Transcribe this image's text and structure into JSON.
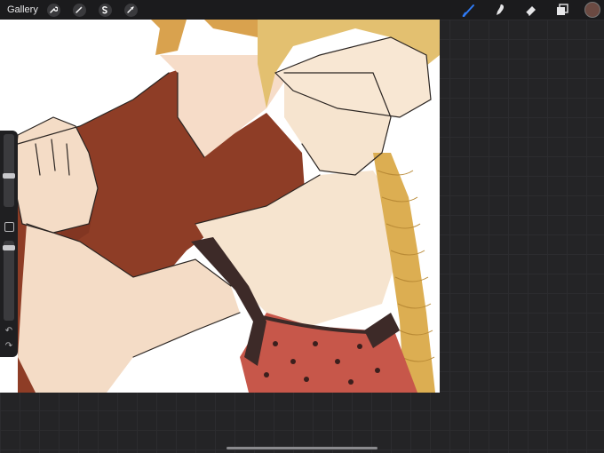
{
  "toolbar": {
    "gallery_label": "Gallery",
    "left_tools": [
      "wrench-icon",
      "magic-wand-icon",
      "selection-icon",
      "transform-icon"
    ],
    "right_tools": [
      "brush-icon",
      "smudge-icon",
      "eraser-icon",
      "layers-icon"
    ],
    "active_tool": "brush-icon",
    "active_color": "#6b4a42",
    "accent": "#2f7bf6"
  },
  "sidebar": {
    "brush_size_level": 0.42,
    "opacity_level": 0.06
  }
}
